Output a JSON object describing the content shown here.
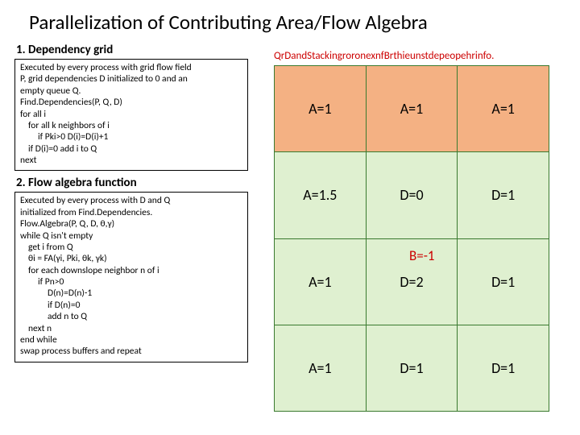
{
  "title": "Parallelization of Contributing Area/Flow Algebra",
  "section1": {
    "heading": "1. Dependency grid",
    "lines": [
      {
        "t": "Executed by every process with grid flow field",
        "i": 0
      },
      {
        "t": "P, grid dependencies D initialized to 0 and an",
        "i": 0
      },
      {
        "t": "empty queue Q.",
        "i": 0
      },
      {
        "t": "Find.Dependencies(P, Q, D)",
        "i": 0
      },
      {
        "t": "for all i",
        "i": 0
      },
      {
        "t": "for all k neighbors of i",
        "i": 1
      },
      {
        "t": "if Pki>0  D(i)=D(i)+1",
        "i": 2
      },
      {
        "t": "if D(i)=0 add i to Q",
        "i": 1
      },
      {
        "t": "next",
        "i": 0
      }
    ]
  },
  "section2": {
    "heading": "2. Flow algebra function",
    "lines": [
      {
        "t": "Executed by every process with D and Q",
        "i": 0
      },
      {
        "t": "initialized from Find.Dependencies.",
        "i": 0
      },
      {
        "t": "Flow.Algebra(P, Q, D, θ,γ)",
        "i": 0
      },
      {
        "t": "while Q isn't empty",
        "i": 0
      },
      {
        "t": "get i from Q",
        "i": 1
      },
      {
        "t": "θi = FA(γi, Pki, θk, γk)",
        "i": 1
      },
      {
        "t": "for each downslope neighbor n of i",
        "i": 1
      },
      {
        "t": "if Pn>0",
        "i": 2
      },
      {
        "t": "D(n)=D(n)-1",
        "i": 3
      },
      {
        "t": "if D(n)=0",
        "i": 3
      },
      {
        "t": "add n to Q",
        "i": 3
      },
      {
        "t": "next n",
        "i": 1
      },
      {
        "t": "end while",
        "i": 0
      },
      {
        "t": "swap process buffers and repeat",
        "i": 0
      }
    ]
  },
  "right": {
    "red_top": "QrDandStackingroronexnfBrthieunstdepeopehrinfo.",
    "b_label": "B=-1",
    "grid": [
      [
        "A=1",
        "A=1",
        "A=1"
      ],
      [
        "A=1.5",
        "D=0",
        "D=1"
      ],
      [
        "A=1",
        "D=2",
        "D=1"
      ],
      [
        "A=1",
        "D=1",
        "D=1"
      ]
    ]
  }
}
